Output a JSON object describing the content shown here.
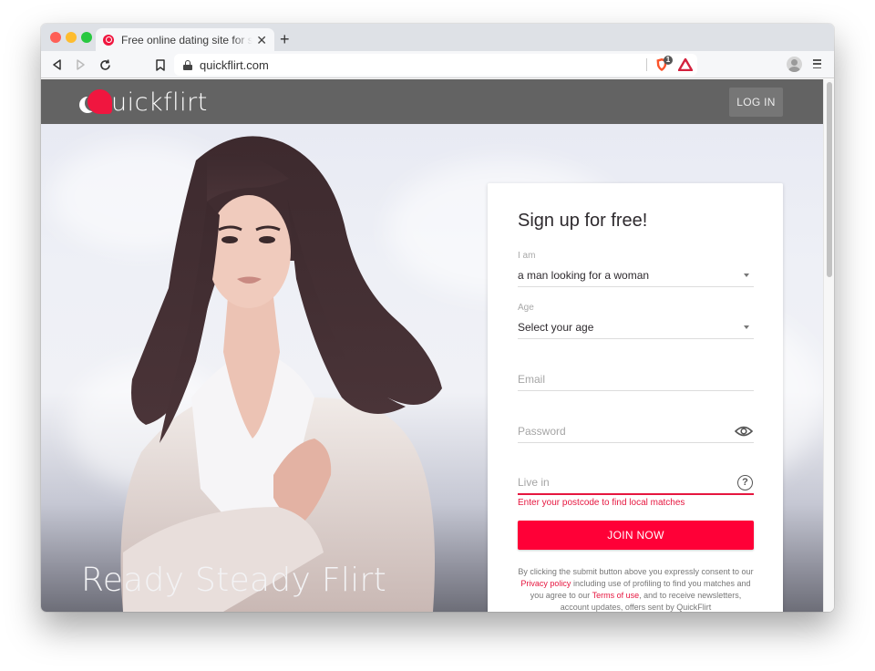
{
  "browser": {
    "tab": {
      "title": "Free online dating site for singles - QuickFlirt",
      "favicon": "quickflirt-favicon"
    },
    "url": "quickflirt.com",
    "shields_count": "1",
    "icons": {
      "back": "back-arrow-icon",
      "forward": "forward-arrow-icon",
      "reload": "reload-icon",
      "bookmark": "bookmark-icon",
      "lock": "lock-icon",
      "shields": "brave-shields-icon",
      "rewards": "brave-rewards-icon",
      "profile": "profile-icon",
      "menu": "hamburger-menu-icon"
    }
  },
  "header": {
    "logo_text": "uickflirt",
    "login_label": "LOG IN"
  },
  "hero": {
    "title": "Ready Steady Flirt"
  },
  "signup": {
    "title": "Sign up for free!",
    "i_am": {
      "label": "I am",
      "value": "a man looking for a woman"
    },
    "age": {
      "label": "Age",
      "value": "Select your age"
    },
    "email": {
      "placeholder": "Email"
    },
    "password": {
      "placeholder": "Password"
    },
    "live_in": {
      "placeholder": "Live in",
      "error": "Enter your postcode to find local matches"
    },
    "join_label": "JOIN NOW",
    "legal": {
      "part1": "By clicking the submit button above you expressly consent to our ",
      "privacy_link": "Privacy policy",
      "part2": " including use of profiling to find you matches and you agree to our ",
      "terms_link": "Terms of use",
      "part3": ", and to receive newsletters, account updates, offers sent by QuickFlirt"
    }
  },
  "colors": {
    "brand_red": "#ff0037",
    "header_gray": "#636363",
    "error_red": "#e6163f"
  }
}
